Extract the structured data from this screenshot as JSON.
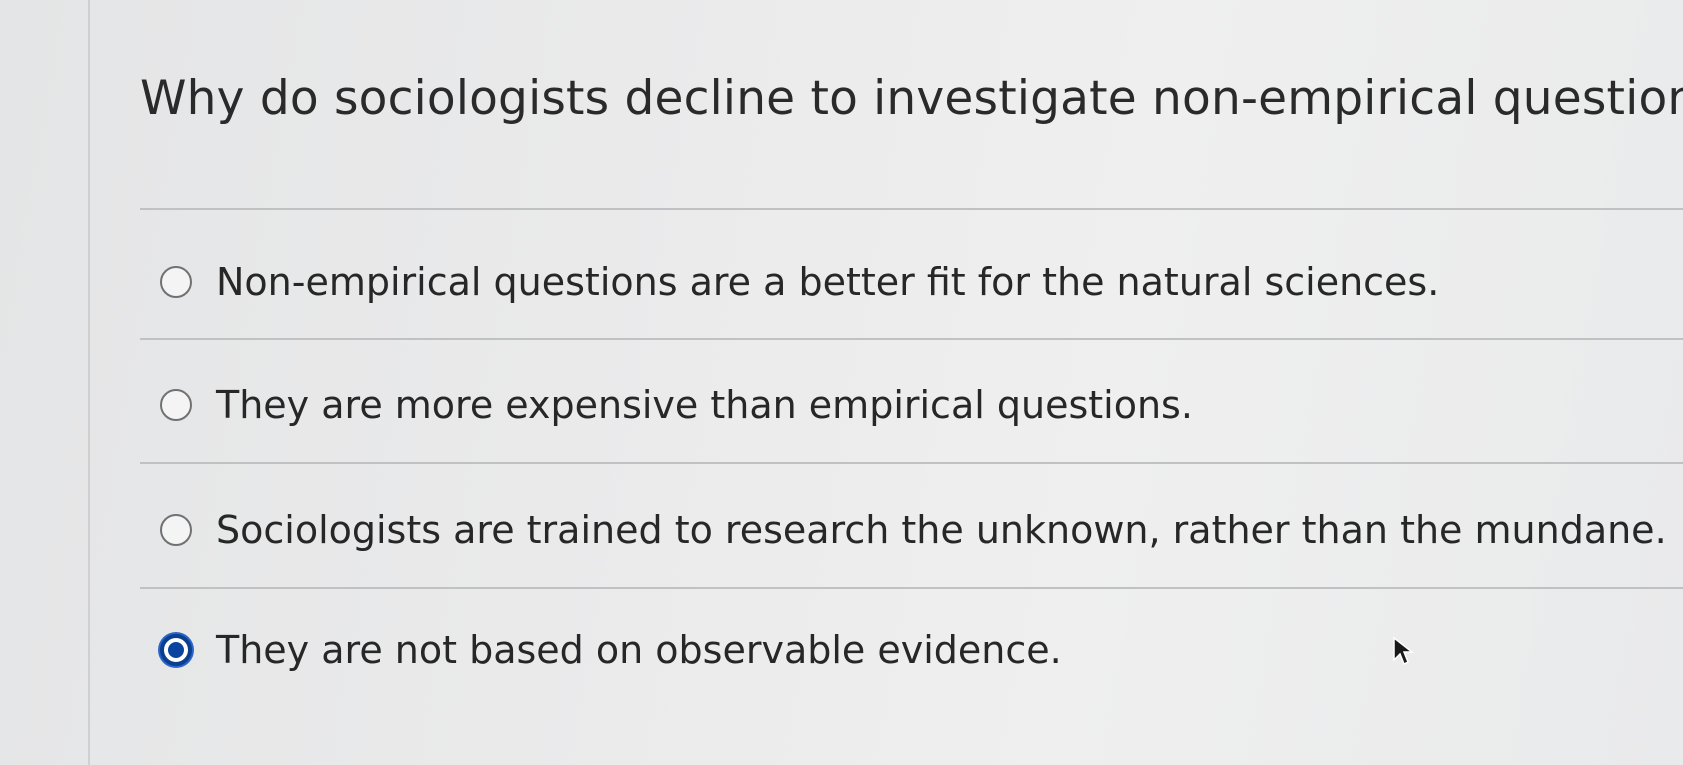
{
  "question": {
    "text": "Why do sociologists decline to investigate non-empirical questions?"
  },
  "options": [
    {
      "label": "Non-empirical questions are a better fit for the natural sciences.",
      "selected": false
    },
    {
      "label": "They are more expensive than empirical questions.",
      "selected": false
    },
    {
      "label": "Sociologists are trained to research the unknown, rather than the mundane.",
      "selected": false
    },
    {
      "label": "They are not based on observable evidence.",
      "selected": true
    }
  ],
  "colors": {
    "selected_radio": "#0b43a0",
    "text": "#272727",
    "divider": "#bfc1c3"
  },
  "icons": {
    "pointer": "mouse-pointer-icon"
  }
}
